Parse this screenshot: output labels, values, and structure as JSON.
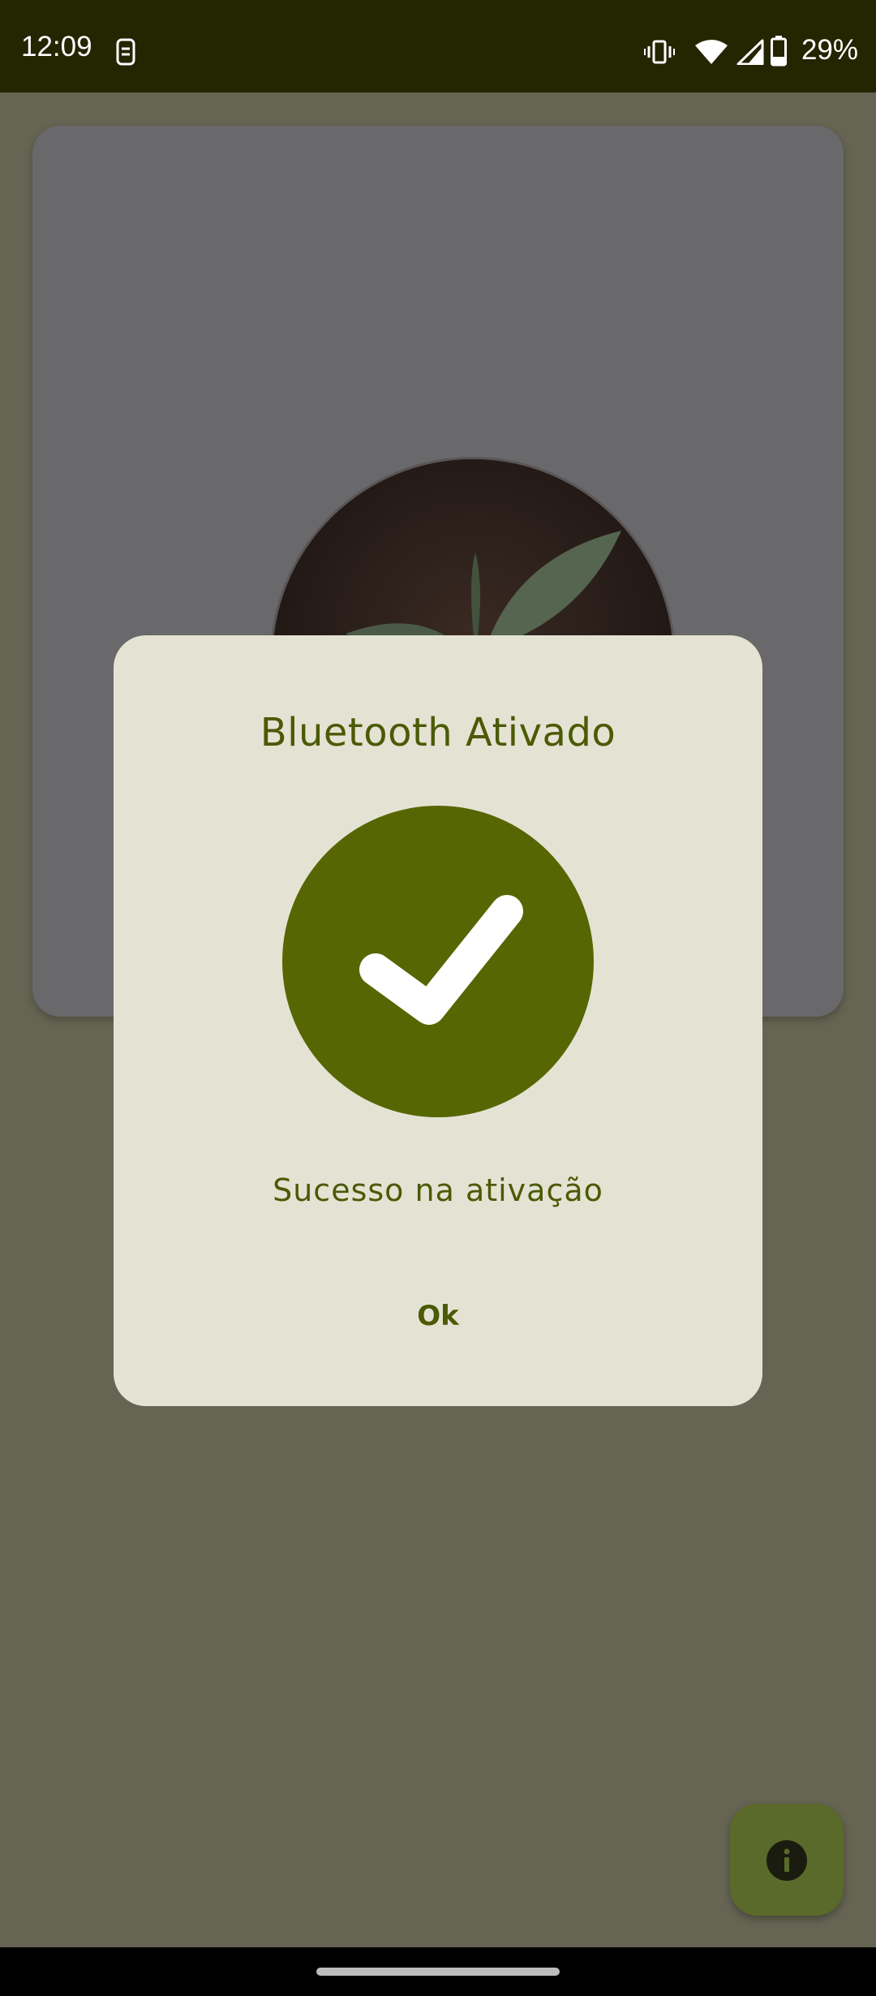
{
  "status_bar": {
    "time": "12:09",
    "battery": "29%",
    "icons": [
      "sim-icon",
      "vibrate-icon",
      "wifi-icon",
      "signal-icon",
      "battery-icon"
    ]
  },
  "card": {
    "image": "plant-seedling-image"
  },
  "dialog": {
    "title": "Bluetooth Ativado",
    "icon": "check-circle-icon",
    "message": "Sucesso na ativação",
    "ok_label": "Ok"
  },
  "fab": {
    "icon": "info-icon"
  },
  "colors": {
    "accent": "#566602",
    "dialog_bg": "#e4e3d3",
    "scrim_bg": "#666452",
    "status_bar": "#232600"
  }
}
